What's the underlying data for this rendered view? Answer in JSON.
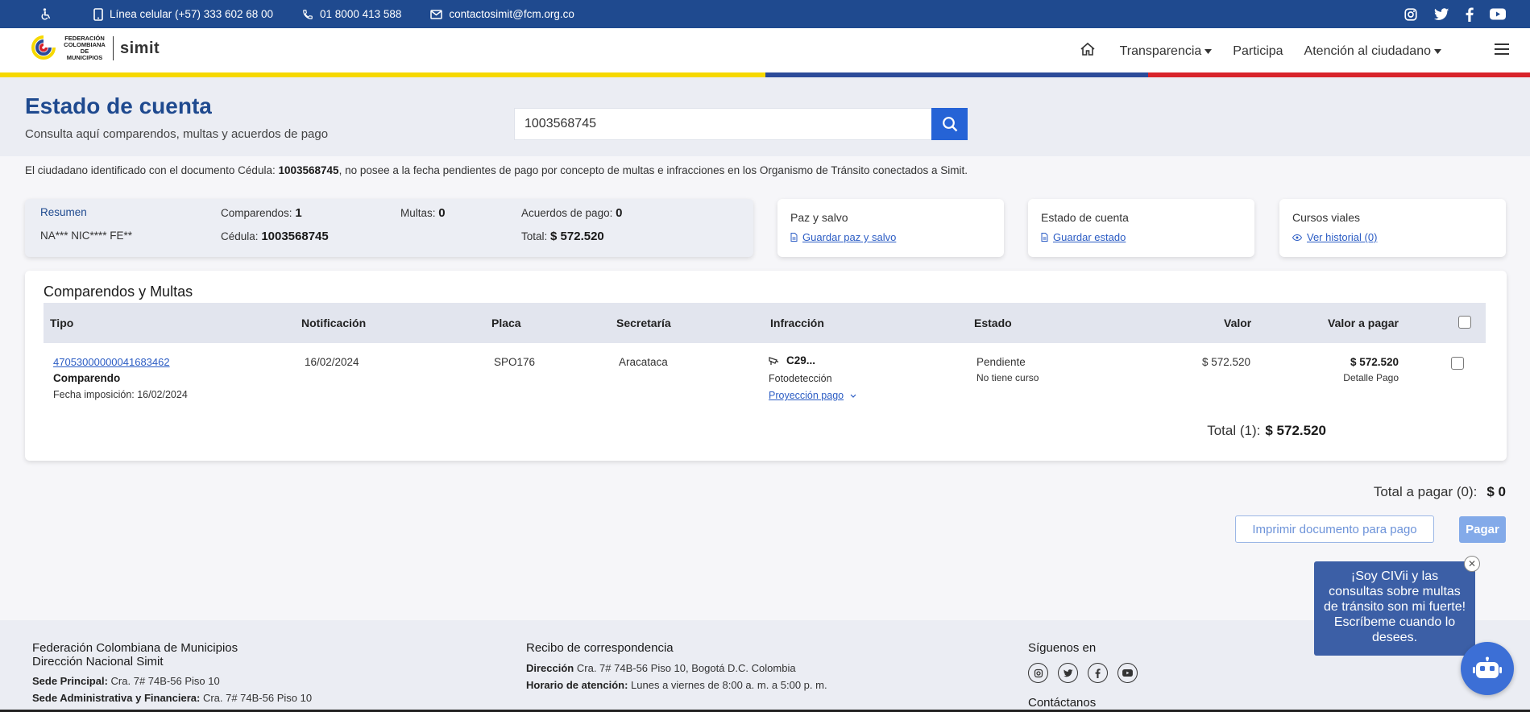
{
  "topbar": {
    "phone_label": "Línea celular (+57) 333 602 68 00",
    "toll_free": "01 8000 413 588",
    "email": "contactosimit@fcm.org.co"
  },
  "header": {
    "logo_text": "FEDERACIÓN COLOMBIANA DE MUNICIPIOS",
    "brand": "simit",
    "nav": {
      "transparency": "Transparencia",
      "participate": "Participa",
      "citizen": "Atención al ciudadano"
    }
  },
  "colors": {
    "primary": "#1f4a8f",
    "accent": "#2563d6",
    "flag_yellow": "#f6d800",
    "flag_blue": "#2c4b99",
    "flag_red": "#d8232a"
  },
  "hero": {
    "title": "Estado de cuenta",
    "subtitle": "Consulta aquí comparendos, multas y acuerdos de pago",
    "search_value": "1003568745"
  },
  "notice": {
    "prefix": "El ciudadano identificado con el documento Cédula:",
    "document": "1003568745",
    "suffix": ", no posee a la fecha pendientes de pago por concepto de multas e infracciones en los Organismo de Tránsito conectados a Simit."
  },
  "summary": {
    "title": "Resumen",
    "name": "NA*** NIC**** FE**",
    "comparendos_label": "Comparendos:",
    "comparendos_value": "1",
    "cedula_label": "Cédula:",
    "cedula_value": "1003568745",
    "multas_label": "Multas:",
    "multas_value": "0",
    "acuerdos_label": "Acuerdos de pago:",
    "acuerdos_value": "0",
    "total_label": "Total:",
    "total_value": "$ 572.520"
  },
  "cards": {
    "paz": {
      "title": "Paz y salvo",
      "link": "Guardar paz y salvo"
    },
    "estado": {
      "title": "Estado de cuenta",
      "link": "Guardar estado"
    },
    "cursos": {
      "title": "Cursos viales",
      "link": "Ver historial (0)"
    }
  },
  "table": {
    "title": "Comparendos y Multas",
    "headers": {
      "tipo": "Tipo",
      "notificacion": "Notificación",
      "placa": "Placa",
      "secretaria": "Secretaría",
      "infraccion": "Infracción",
      "estado": "Estado",
      "valor": "Valor",
      "valor_pagar": "Valor a pagar"
    },
    "rows": [
      {
        "number": "47053000000041683462",
        "tipo": "Comparendo",
        "fecha_imposicion": "Fecha imposición: 16/02/2024",
        "notificacion": "16/02/2024",
        "placa": "SPO176",
        "secretaria": "Aracataca",
        "infraccion_code": "C29...",
        "infraccion_source": "Fotodetección",
        "proyeccion": "Proyección pago",
        "estado": "Pendiente",
        "curso": "No tiene curso",
        "valor": "$ 572.520",
        "valor_pagar": "$ 572.520",
        "detalle": "Detalle Pago"
      }
    ],
    "total_label": "Total (1):",
    "total_value": "$ 572.520"
  },
  "payment": {
    "total_label": "Total a pagar (0):",
    "total_value": "$ 0",
    "print_button": "Imprimir documento para pago",
    "pay_button": "Pagar"
  },
  "footer": {
    "org": "Federación Colombiana de Municipios",
    "dept": "Dirección Nacional Simit",
    "sede_label": "Sede Principal:",
    "sede_value": "Cra. 7# 74B-56 Piso 10",
    "sede_adm_label": "Sede Administrativa y Financiera:",
    "sede_adm_value": "Cra. 7# 74B-56 Piso 10",
    "recibo_title": "Recibo de correspondencia",
    "direccion_label": "Dirección",
    "direccion_value": "Cra. 7# 74B-56 Piso 10, Bogotá D.C. Colombia",
    "horario_label": "Horario de atención:",
    "horario_value": "Lunes a viernes de 8:00 a. m. a 5:00 p. m.",
    "follow": "Síguenos en",
    "contact": "Contáctanos"
  },
  "chat": {
    "message": "¡Soy CIVii y las consultas sobre multas de tránsito son mi fuerte! Escríbeme cuando lo desees."
  }
}
